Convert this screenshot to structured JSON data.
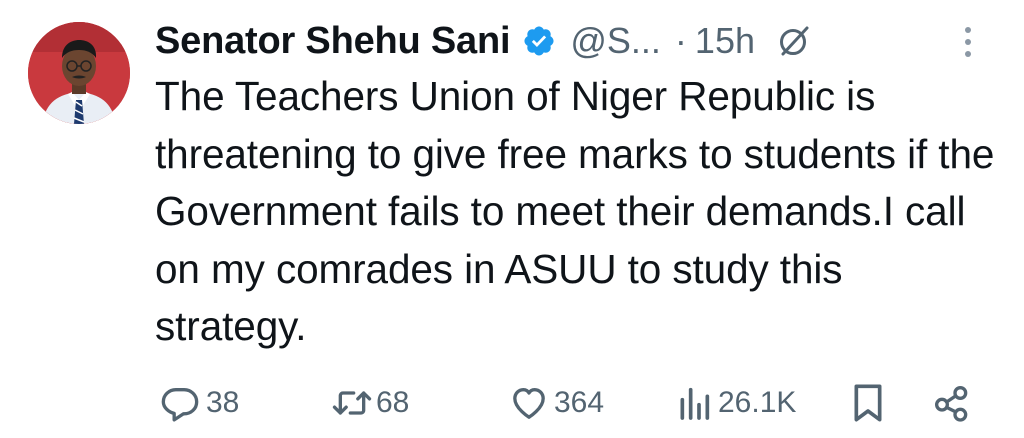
{
  "tweet": {
    "author": {
      "display_name": "Senator Shehu Sani",
      "handle": "@S...",
      "verified": true,
      "avatar_icon": "avatar-photo"
    },
    "separator": "·",
    "time": "15h",
    "text": "The Teachers Union of Niger Republic is threatening to give free marks to students if the Government fails to meet their demands.I call on my comrades in ASUU to study this strategy.",
    "actions": {
      "replies": "38",
      "reposts": "68",
      "likes": "364",
      "views": "26.1K"
    }
  },
  "colors": {
    "text": "#0f1419",
    "secondary": "#536471",
    "verified_badge": "#1d9bf0"
  }
}
